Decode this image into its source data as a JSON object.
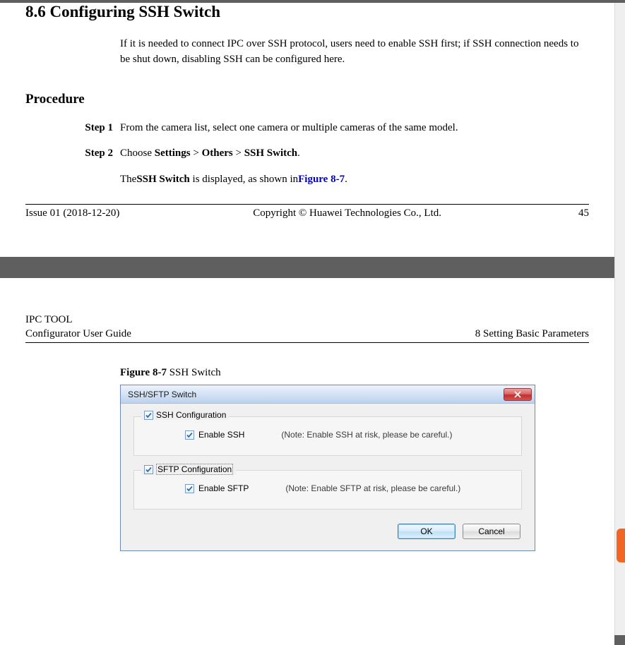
{
  "section": {
    "number": "8.6",
    "title": "Configuring SSH Switch",
    "intro": "If it is needed to connect IPC over SSH protocol, users need to enable SSH first; if SSH connection needs to be shut down, disabling SSH can be configured here."
  },
  "procedure": {
    "heading": "Procedure",
    "steps": [
      {
        "label": "Step 1",
        "text": "From the camera list, select one camera or multiple cameras of the same model."
      },
      {
        "label": "Step 2",
        "prefix": "Choose ",
        "path_a": "Settings",
        "gt1": " > ",
        "path_b": "Others",
        "gt2": " > ",
        "path_c": "SSH Switch",
        "suffix": ".",
        "sub_prefix": "The",
        "sub_bold": "SSH Switch",
        "sub_mid": " is displayed, as shown in",
        "figure_link": "Figure 8-7",
        "sub_end": "."
      }
    ]
  },
  "footer1": {
    "issue": "Issue 01 (2018-12-20)",
    "copyright": "Copyright © Huawei Technologies Co., Ltd.",
    "page": "45"
  },
  "header2": {
    "line1": "IPC TOOL",
    "line2": "Configurator User Guide",
    "right": "8 Setting Basic Parameters"
  },
  "figure": {
    "label_bold": "Figure 8-7",
    "label_rest": " SSH Switch"
  },
  "dialog": {
    "title": "SSH/SFTP Switch",
    "group1": {
      "legend": "SSH Configuration",
      "check_label": "Enable SSH",
      "note": "(Note: Enable SSH at risk, please be careful.)"
    },
    "group2": {
      "legend": "SFTP Configuration",
      "check_label": "Enable SFTP",
      "note": "(Note: Enable SFTP at risk, please be careful.)"
    },
    "ok": "OK",
    "cancel": "Cancel"
  }
}
